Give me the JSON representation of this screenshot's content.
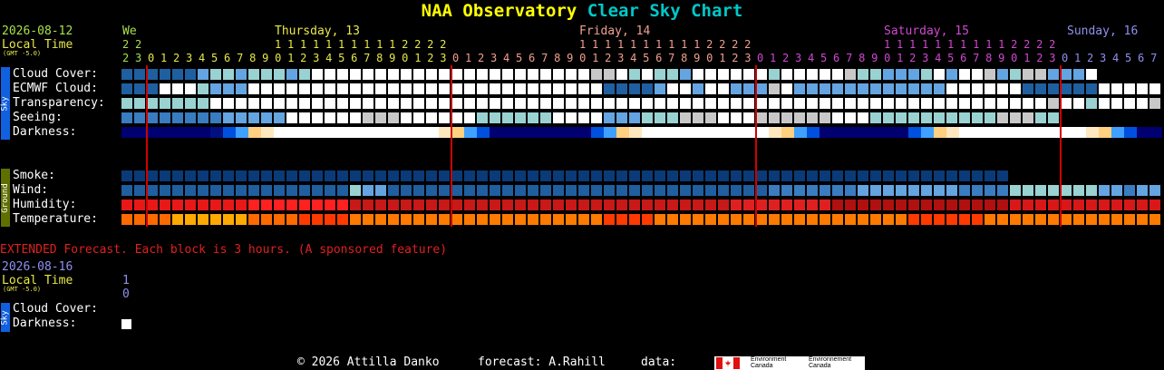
{
  "title": {
    "part1": "NAA Observatory",
    "part2": "Clear Sky Chart",
    "color1": "#ffff00",
    "color2": "#00c8c8"
  },
  "header": {
    "date": "2026-08-12",
    "local_time": "Local Time",
    "gmt": "(GMT -5.0)",
    "days": [
      {
        "label": "We",
        "color": "#a8e048"
      },
      {
        "label": "Thursday, 13",
        "color": "#e8e848"
      },
      {
        "label": "Friday, 14",
        "color": "#f0a090"
      },
      {
        "label": "Saturday, 15",
        "color": "#d048d0"
      },
      {
        "label": "Sunday, 16",
        "color": "#9090f0"
      }
    ],
    "hour_tens": {
      "we": "2 2",
      "thu": "1 1 1 1 1 1 1 1 1 1 2 2 2 2",
      "fri": "1 1 1 1 1 1 1 1 1 1 2 2 2 2",
      "sat": "1 1 1 1 1 1 1 1 1 1 2 2 2 2"
    },
    "hour_ones": {
      "we": "2 3",
      "thu": "0 1 2 3 4 5 6 7 8 9 0 1 2 3 4 5 6 7 8 9 0 1 2 3",
      "fri": "0 1 2 3 4 5 6 7 8 9 0 1 2 3 4 5 6 7 8 9 0 1 2 3",
      "sat": "0 1 2 3 4 5 6 7 8 9 0 1 2 3 4 5 6 7 8 9 0 1 2 3",
      "sun": "0 1 2 3 4 5 6 7"
    }
  },
  "sections": {
    "sky": "Sky",
    "ground": "Ground"
  },
  "rows": {
    "cloud": "Cloud Cover:",
    "ecmwf": "ECMWF Cloud:",
    "transparency": "Transparency:",
    "seeing": "Seeing:",
    "darkness": "Darkness:",
    "smoke": "Smoke:",
    "wind": "Wind:",
    "humidity": "Humidity:",
    "temperature": "Temperature:"
  },
  "extended": {
    "note": "EXTENDED Forecast. Each block is 3 hours. (A sponsored feature)",
    "date": "2026-08-16",
    "local_time": "Local Time",
    "gmt": "(GMT -5.0)",
    "hour_tens": "1",
    "hour_ones": "0",
    "cloud": "Cloud Cover:",
    "darkness": "Darkness:"
  },
  "footer": {
    "copyright": "© 2026 Attilla Danko",
    "forecast": "forecast: A.Rahill",
    "data": "data:",
    "logo_en": "Environment Canada",
    "logo_fr": "Environnement Canada"
  },
  "colors": {
    "sky_tab": "#1060e0",
    "ground_tab": "#607000",
    "midnight_line": "#d00000",
    "label": "#ffffff",
    "date": "#a8e048",
    "local": "#e8e848",
    "ext_note": "#e02020",
    "ext_date": "#9090f0"
  }
}
